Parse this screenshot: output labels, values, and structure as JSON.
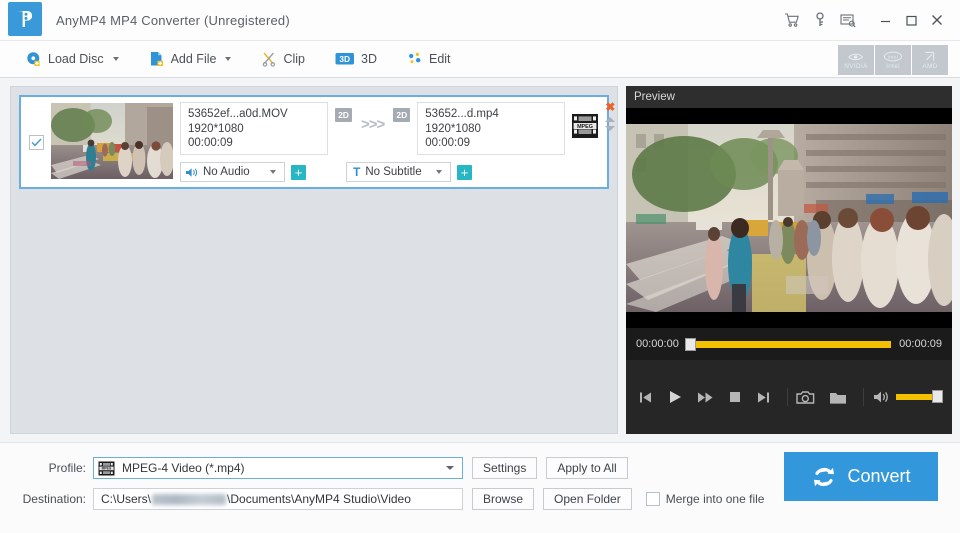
{
  "window": {
    "title": "AnyMP4 MP4 Converter (Unregistered)",
    "logo_icon": "film-reel-logo-icon",
    "accent_color": "#3398db",
    "controls": [
      {
        "name": "cart-icon",
        "label": "Buy"
      },
      {
        "name": "key-icon",
        "label": "Register"
      },
      {
        "name": "feedback-icon",
        "label": "Feedback"
      },
      {
        "name": "minimize-icon",
        "label": "Minimize"
      },
      {
        "name": "maximize-icon",
        "label": "Maximize"
      },
      {
        "name": "close-icon",
        "label": "Close"
      }
    ]
  },
  "toolbar": {
    "items": [
      {
        "label": "Load Disc",
        "icon": "load-disc-icon",
        "has_caret": true
      },
      {
        "label": "Add File",
        "icon": "add-file-icon",
        "has_caret": true
      },
      {
        "label": "Clip",
        "icon": "scissors-icon",
        "has_caret": false
      },
      {
        "label": "3D",
        "icon": "three-d-icon",
        "has_caret": false
      },
      {
        "label": "Edit",
        "icon": "edit-sparkle-icon",
        "has_caret": false
      }
    ],
    "acceleration": [
      {
        "label": "NVIDIA",
        "enabled": false
      },
      {
        "label": "Intel",
        "enabled": false
      },
      {
        "label": "AMD",
        "enabled": false
      }
    ]
  },
  "file_list": {
    "items": [
      {
        "checked": true,
        "thumbnail": "street-scene-thumbnail",
        "source": {
          "filename": "53652ef...a0d.MOV",
          "resolution": "1920*1080",
          "duration": "00:00:09",
          "dimension_tag": "2D"
        },
        "convert_arrow": ">>>",
        "output": {
          "filename": "53652...d.mp4",
          "resolution": "1920*1080",
          "duration": "00:00:09",
          "dimension_tag": "2D"
        },
        "format_icon": "mpeg-film-icon",
        "audio_track": "No Audio",
        "subtitle_track": "No Subtitle",
        "add_audio_label": "+",
        "add_subtitle_label": "+",
        "remove_label": "✖"
      }
    ]
  },
  "preview": {
    "header": "Preview",
    "start_time": "00:00:00",
    "end_time": "00:00:09",
    "seek_percent": 0,
    "volume_percent": 100,
    "controls": [
      {
        "name": "previous-icon",
        "glyph": "prev"
      },
      {
        "name": "play-icon",
        "glyph": "play"
      },
      {
        "name": "fast-forward-icon",
        "glyph": "ff"
      },
      {
        "name": "stop-icon",
        "glyph": "stop"
      },
      {
        "name": "next-icon",
        "glyph": "next"
      },
      {
        "name": "snapshot-camera-icon",
        "glyph": "camera"
      },
      {
        "name": "open-folder-icon",
        "glyph": "folder"
      },
      {
        "name": "volume-icon",
        "glyph": "volume"
      }
    ]
  },
  "bottom": {
    "profile_label": "Profile:",
    "profile_value": "MPEG-4 Video (*.mp4)",
    "profile_icon": "mpeg-format-icon",
    "destination_label": "Destination:",
    "destination_prefix": "C:\\Users\\",
    "destination_suffix": "\\Documents\\AnyMP4 Studio\\Video",
    "settings_label": "Settings",
    "apply_all_label": "Apply to All",
    "browse_label": "Browse",
    "open_folder_label": "Open Folder",
    "merge_label": "Merge into one file",
    "merge_checked": false,
    "convert_label": "Convert",
    "convert_icon": "convert-arrows-icon"
  }
}
